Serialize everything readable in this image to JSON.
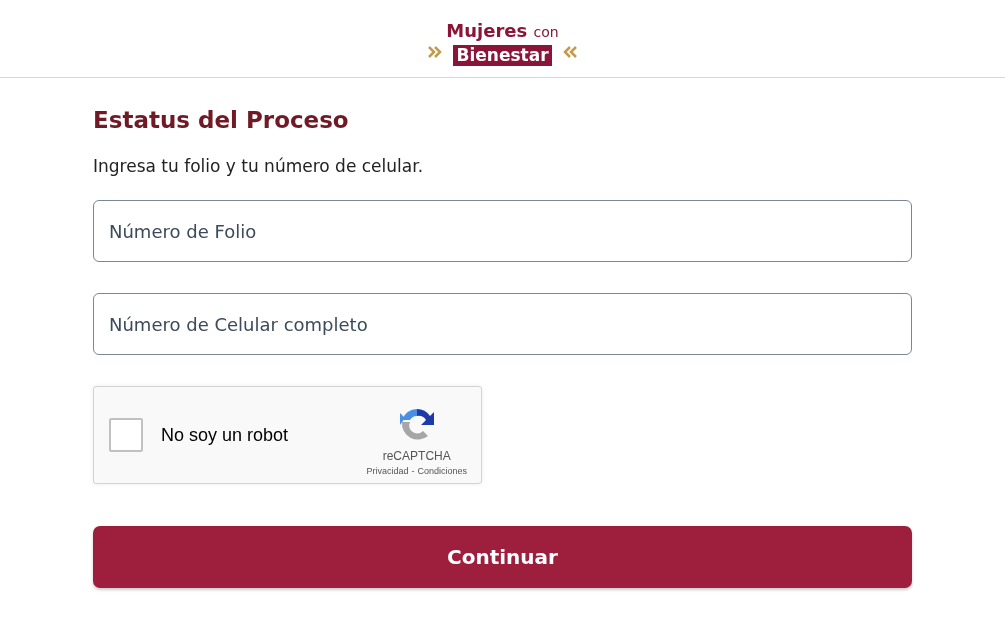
{
  "logo": {
    "line_1": "Mujeres",
    "line_1_small": "con",
    "line_2": "Bienestar"
  },
  "title": "Estatus del Proceso",
  "instructions": "Ingresa tu folio y tu número de celular.",
  "fields": [
    {
      "placeholder": "Número de Folio"
    },
    {
      "placeholder": "Número de Celular completo"
    }
  ],
  "captcha": {
    "label": "No soy un robot",
    "checked": false,
    "brand": "reCAPTCHA",
    "links": [
      "Privacidad",
      "Condiciones"
    ],
    "separator": "-"
  },
  "submit_button": "Continuar"
}
